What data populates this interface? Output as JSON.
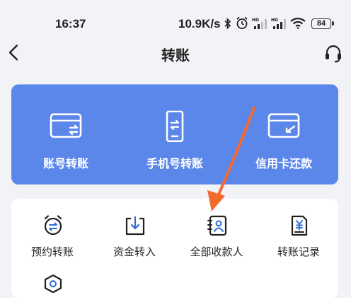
{
  "status_bar": {
    "time": "16:37",
    "net_speed": "10.9K/s",
    "battery": "84"
  },
  "nav": {
    "title": "转账",
    "back_icon": "chevron-left-icon",
    "support_icon": "headset-icon"
  },
  "primary_actions": [
    {
      "label": "账号转账",
      "icon": "card-transfer-icon"
    },
    {
      "label": "手机号转账",
      "icon": "phone-transfer-icon"
    },
    {
      "label": "信用卡还款",
      "icon": "credit-card-repay-icon"
    }
  ],
  "secondary_actions": [
    {
      "label": "预约转账",
      "icon": "alarm-transfer-icon"
    },
    {
      "label": "资金转入",
      "icon": "fund-in-icon"
    },
    {
      "label": "全部收款人",
      "icon": "contacts-book-icon"
    },
    {
      "label": "转账记录",
      "icon": "yuan-record-icon"
    }
  ],
  "colors": {
    "primary_card": "#5b86ea",
    "icon_blue": "#2f6bd8",
    "annotation_arrow": "#f26a2e"
  }
}
